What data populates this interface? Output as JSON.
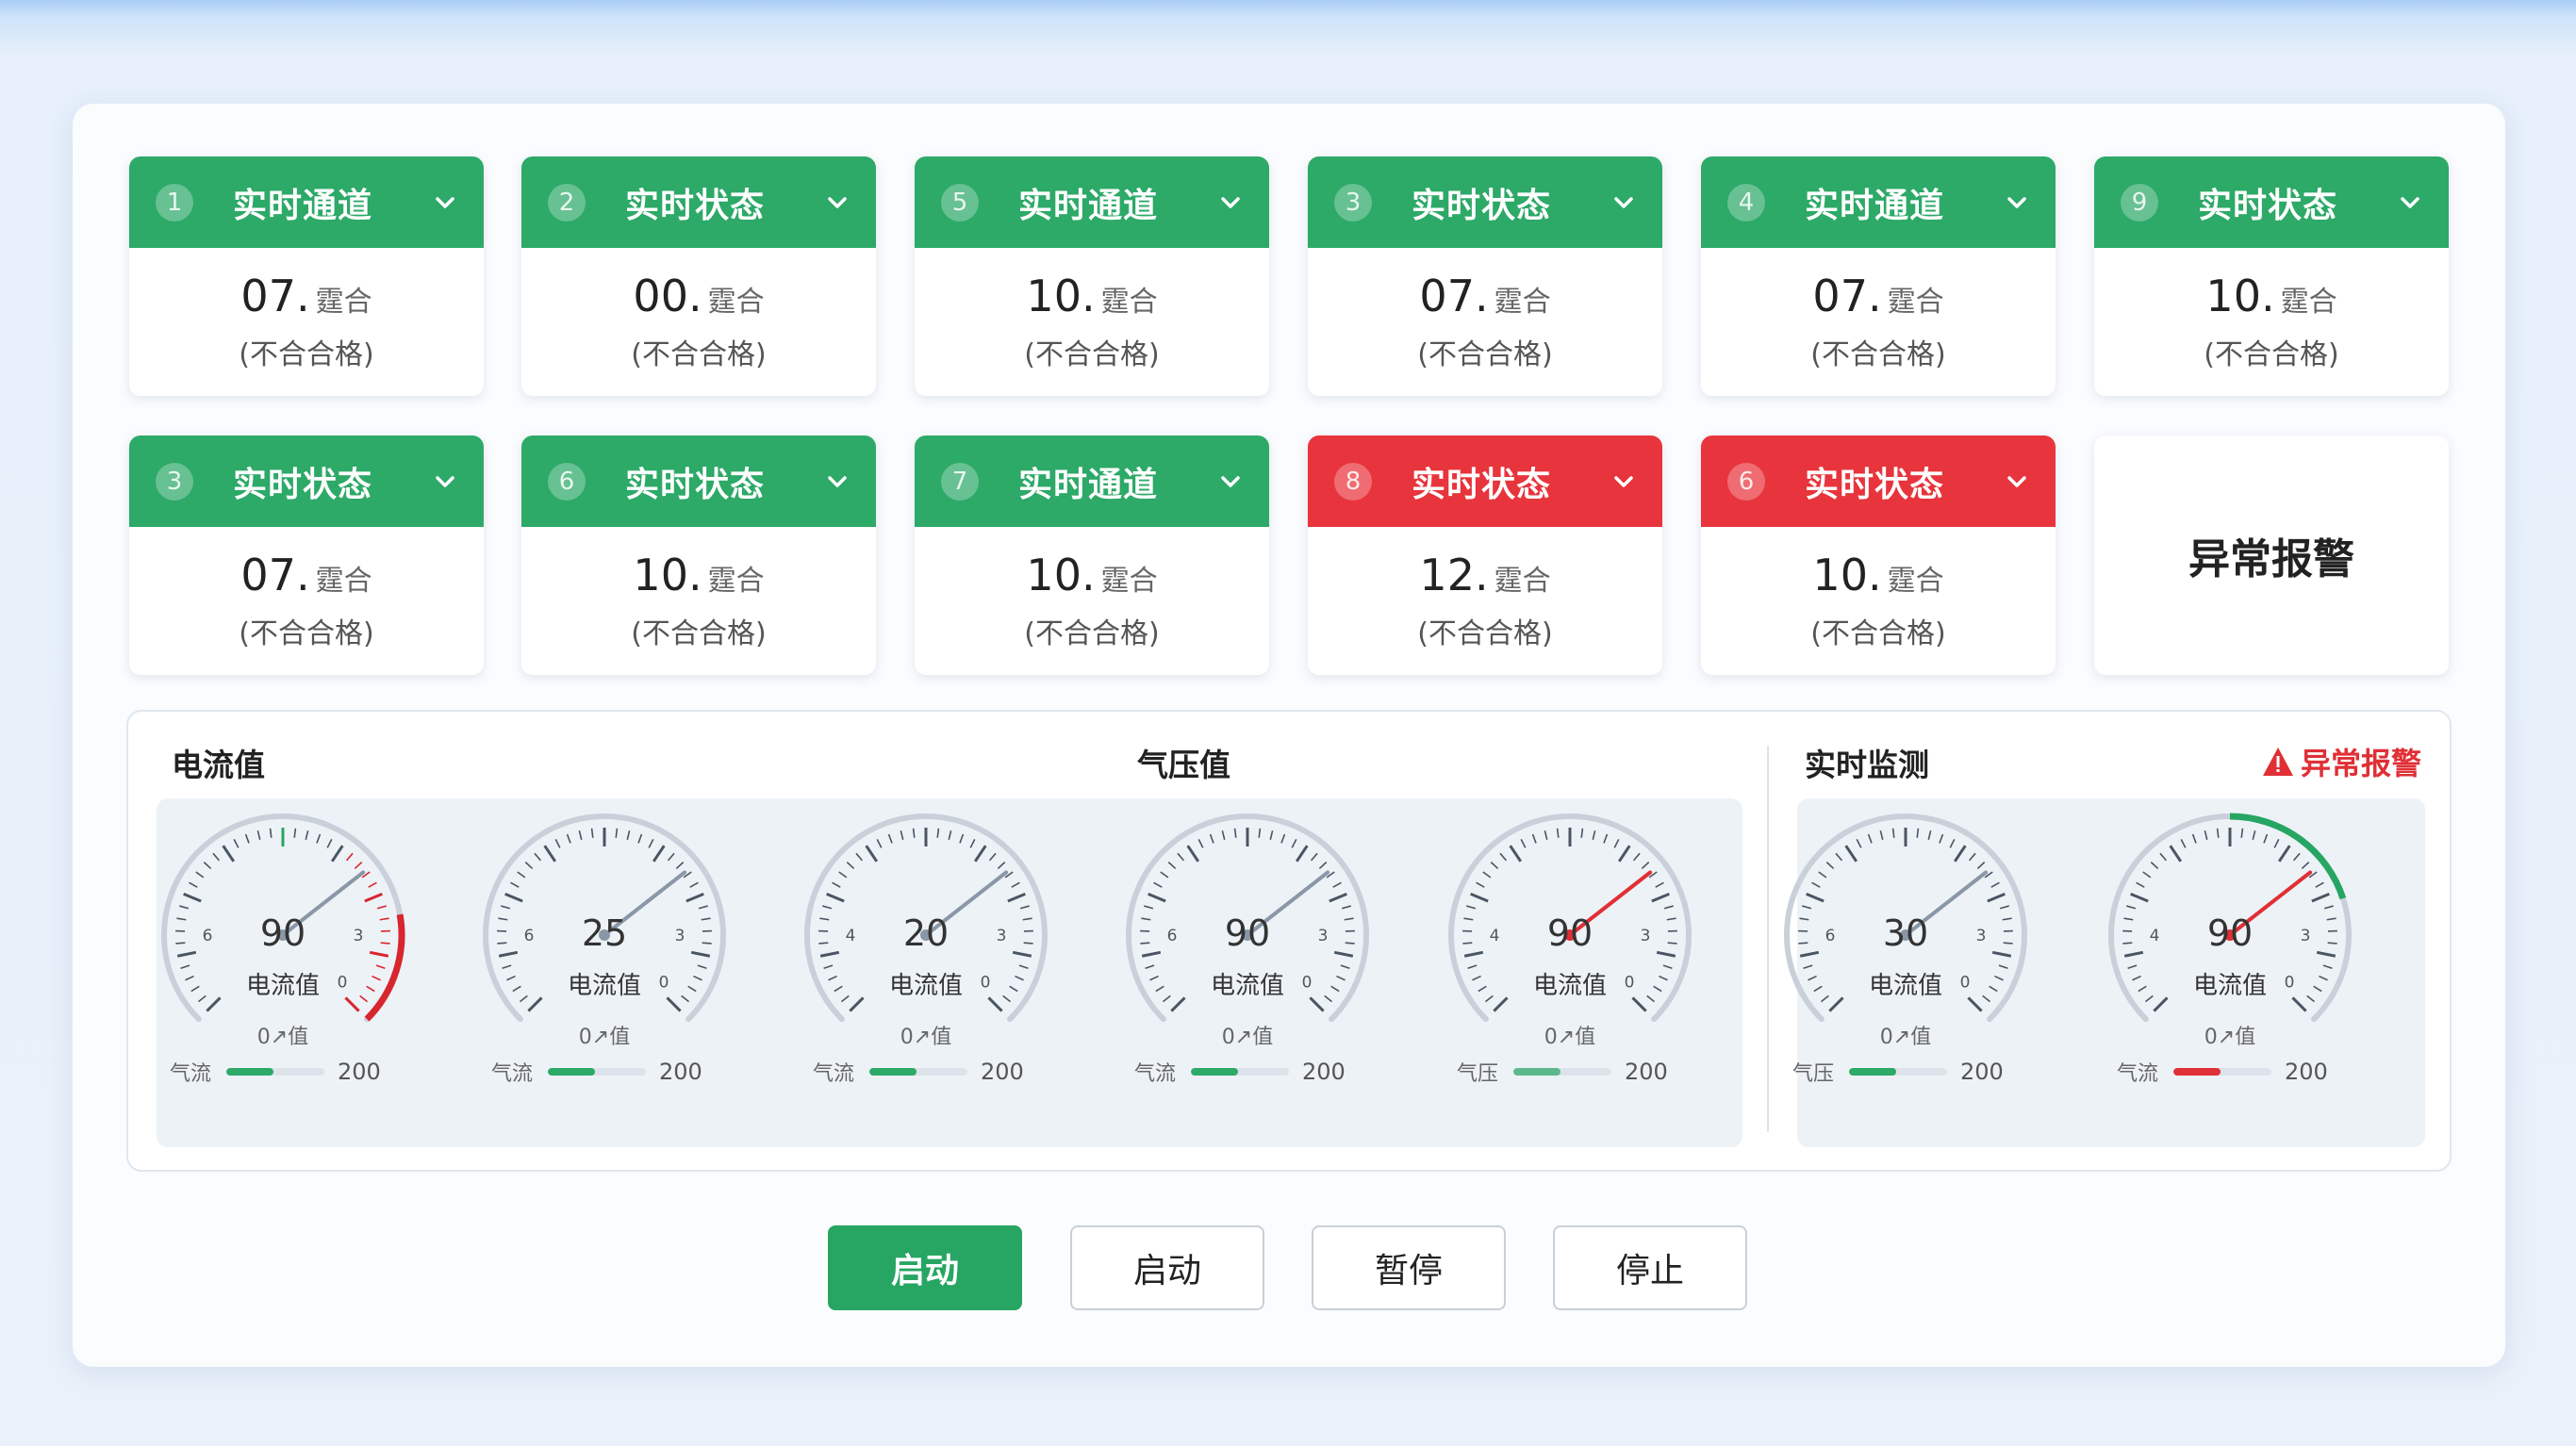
{
  "colors": {
    "green": "#2da968",
    "red": "#e8343c",
    "alarm": "#e02f35"
  },
  "cards": [
    {
      "num": "1",
      "title": "实时通道",
      "value": "07.",
      "unit": "霆合",
      "sub": "(不合合格)",
      "status": "green"
    },
    {
      "num": "2",
      "title": "实时状态",
      "value": "00.",
      "unit": "霆合",
      "sub": "(不合合格)",
      "status": "green"
    },
    {
      "num": "5",
      "title": "实时通道",
      "value": "10.",
      "unit": "霆合",
      "sub": "(不合合格)",
      "status": "green"
    },
    {
      "num": "3",
      "title": "实时状态",
      "value": "07.",
      "unit": "霆合",
      "sub": "(不合合格)",
      "status": "green"
    },
    {
      "num": "4",
      "title": "实时通道",
      "value": "07.",
      "unit": "霆合",
      "sub": "(不合合格)",
      "status": "green"
    },
    {
      "num": "9",
      "title": "实时状态",
      "value": "10.",
      "unit": "霆合",
      "sub": "(不合合格)",
      "status": "green"
    },
    {
      "num": "3",
      "title": "实时状态",
      "value": "07.",
      "unit": "霆合",
      "sub": "(不合合格)",
      "status": "green"
    },
    {
      "num": "6",
      "title": "实时状态",
      "value": "10.",
      "unit": "霆合",
      "sub": "(不合合格)",
      "status": "green"
    },
    {
      "num": "7",
      "title": "实时通道",
      "value": "10.",
      "unit": "霆合",
      "sub": "(不合合格)",
      "status": "green"
    },
    {
      "num": "8",
      "title": "实时状态",
      "value": "12.",
      "unit": "霆合",
      "sub": "(不合合格)",
      "status": "red"
    },
    {
      "num": "6",
      "title": "实时状态",
      "value": "10.",
      "unit": "霆合",
      "sub": "(不合合格)",
      "status": "red"
    }
  ],
  "alarm_card": "异常报警",
  "sections": {
    "current": "电流值",
    "pressure": "气压值",
    "monitor": "实时监测"
  },
  "alarm_tag": "异常报警",
  "gauges": [
    {
      "value": "90",
      "label": "电流值",
      "bottom": "0↗值",
      "bar_label": "气流",
      "bar_max": "200",
      "bar_level": 0.48,
      "bar_color": "#2da968",
      "left_tick": "6",
      "right_tick": "3",
      "zero": "0",
      "arc": "red-right",
      "needle_color": "#8a97a6"
    },
    {
      "value": "25",
      "label": "电流值",
      "bottom": "0↗值",
      "bar_label": "气流",
      "bar_max": "200",
      "bar_level": 0.48,
      "bar_color": "#2da968",
      "left_tick": "6",
      "right_tick": "3",
      "zero": "0",
      "arc": "none",
      "needle_color": "#8a97a6"
    },
    {
      "value": "20",
      "label": "电流值",
      "bottom": "0↗值",
      "bar_label": "气流",
      "bar_max": "200",
      "bar_level": 0.48,
      "bar_color": "#2da968",
      "left_tick": "4",
      "right_tick": "3",
      "zero": "0",
      "arc": "none",
      "needle_color": "#8a97a6"
    },
    {
      "value": "90",
      "label": "电流值",
      "bottom": "0↗值",
      "bar_label": "气流",
      "bar_max": "200",
      "bar_level": 0.48,
      "bar_color": "#2da968",
      "left_tick": "6",
      "right_tick": "3",
      "zero": "0",
      "arc": "none",
      "needle_color": "#8a97a6"
    },
    {
      "value": "90",
      "label": "电流值",
      "bottom": "0↗值",
      "bar_label": "气压",
      "bar_max": "200",
      "bar_level": 0.48,
      "bar_color": "#5cb88a",
      "left_tick": "4",
      "right_tick": "3",
      "zero": "0",
      "arc": "none",
      "needle_color": "#e02f35"
    },
    {
      "value": "30",
      "label": "电流值",
      "bottom": "0↗值",
      "bar_label": "气压",
      "bar_max": "200",
      "bar_level": 0.48,
      "bar_color": "#2da968",
      "left_tick": "6",
      "right_tick": "3",
      "zero": "0",
      "arc": "none",
      "needle_color": "#8a97a6"
    },
    {
      "value": "90",
      "label": "电流值",
      "bottom": "0↗值",
      "bar_label": "气流",
      "bar_max": "200",
      "bar_level": 0.48,
      "bar_color": "#e02f35",
      "left_tick": "4",
      "right_tick": "3",
      "zero": "0",
      "arc": "green-top",
      "needle_color": "#e02f35"
    }
  ],
  "buttons": [
    {
      "label": "启动",
      "primary": true
    },
    {
      "label": "启动",
      "primary": false
    },
    {
      "label": "暂停",
      "primary": false
    },
    {
      "label": "停止",
      "primary": false
    }
  ]
}
